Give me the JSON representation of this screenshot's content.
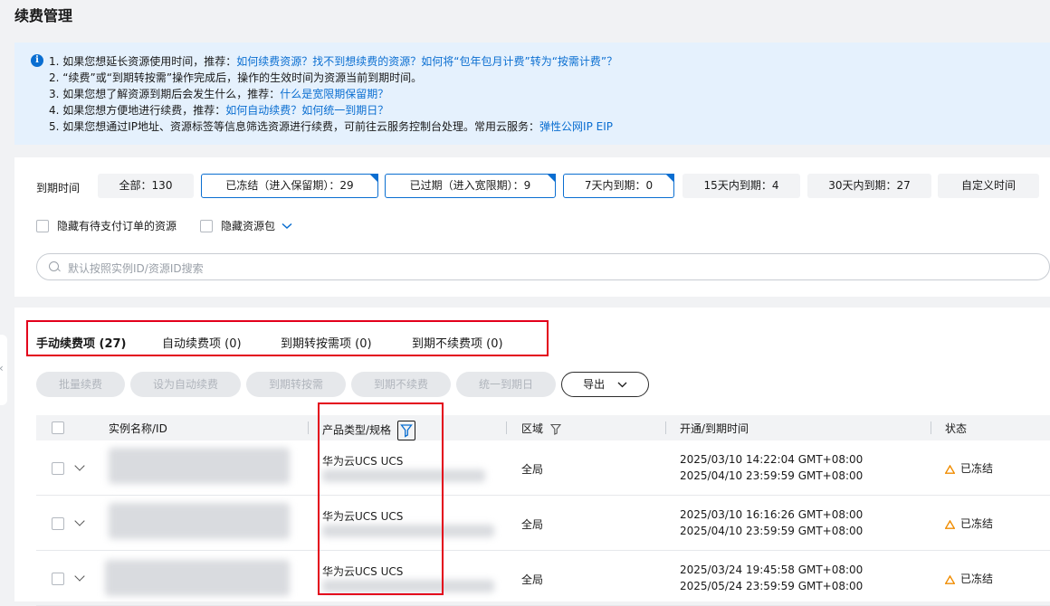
{
  "page": {
    "title": "续费管理"
  },
  "info": {
    "lines": [
      {
        "text": "1. 如果您想延长资源使用时间，推荐：",
        "link": "如何续费资源？找不到想续费的资源？如何将“包年包月计费”转为“按需计费”？"
      },
      {
        "text": "2. “续费”或“到期转按需”操作完成后，操作的生效时间为资源当前到期时间。",
        "link": ""
      },
      {
        "text": "3. 如果您想了解资源到期后会发生什么，推荐：",
        "link": "什么是宽限期保留期？"
      },
      {
        "text": "4. 如果您想方便地进行续费，推荐：",
        "link": "如何自动续费？如何统一到期日？"
      },
      {
        "text": "5. 如果您想通过IP地址、资源标签等信息筛选资源进行续费，可前往云服务控制台处理。常用云服务：",
        "link": "弹性公网IP EIP"
      }
    ]
  },
  "filter": {
    "label": "到期时间",
    "chips": [
      {
        "label": "全部：130",
        "selected": false
      },
      {
        "label": "已冻结（进入保留期）：29",
        "selected": true
      },
      {
        "label": "已过期（进入宽限期）：9",
        "selected": true
      },
      {
        "label": "7天内到期：0",
        "selected": true
      },
      {
        "label": "15天内到期：4",
        "selected": false
      },
      {
        "label": "30天内到期：27",
        "selected": false
      },
      {
        "label": "自定义时间",
        "selected": false
      }
    ],
    "hide_pending": "隐藏有待支付订单的资源",
    "hide_package": "隐藏资源包",
    "search_placeholder": "默认按照实例ID/资源ID搜索"
  },
  "tabs": [
    {
      "label": "手动续费项 (27)",
      "active": true
    },
    {
      "label": "自动续费项 (0)",
      "active": false
    },
    {
      "label": "到期转按需项 (0)",
      "active": false
    },
    {
      "label": "到期不续费项 (0)",
      "active": false
    }
  ],
  "toolbar": {
    "batch_renew": "批量续费",
    "set_auto": "设为自动续费",
    "to_ondemand": "到期转按需",
    "no_renew": "到期不续费",
    "unify": "统一到期日",
    "export": "导出"
  },
  "table": {
    "columns": {
      "name": "实例名称/ID",
      "product": "产品类型/规格",
      "region": "区域",
      "time": "开通/到期时间",
      "status": "状态"
    },
    "rows": [
      {
        "product": "华为云UCS UCS",
        "region": "全局",
        "open": "2025/03/10 14:22:04 GMT+08:00",
        "expire": "2025/04/10 23:59:59 GMT+08:00",
        "status": "已冻结"
      },
      {
        "product": "华为云UCS UCS",
        "region": "全局",
        "open": "2025/03/10 16:16:26 GMT+08:00",
        "expire": "2025/04/10 23:59:59 GMT+08:00",
        "status": "已冻结"
      },
      {
        "product": "华为云UCS UCS",
        "region": "全局",
        "open": "2025/03/24 19:45:58 GMT+08:00",
        "expire": "2025/05/24 23:59:59 GMT+08:00",
        "status": "已冻结"
      }
    ]
  },
  "colors": {
    "accent": "#0a6ed1",
    "highlight": "#e3001b",
    "warning": "#f08c00"
  }
}
